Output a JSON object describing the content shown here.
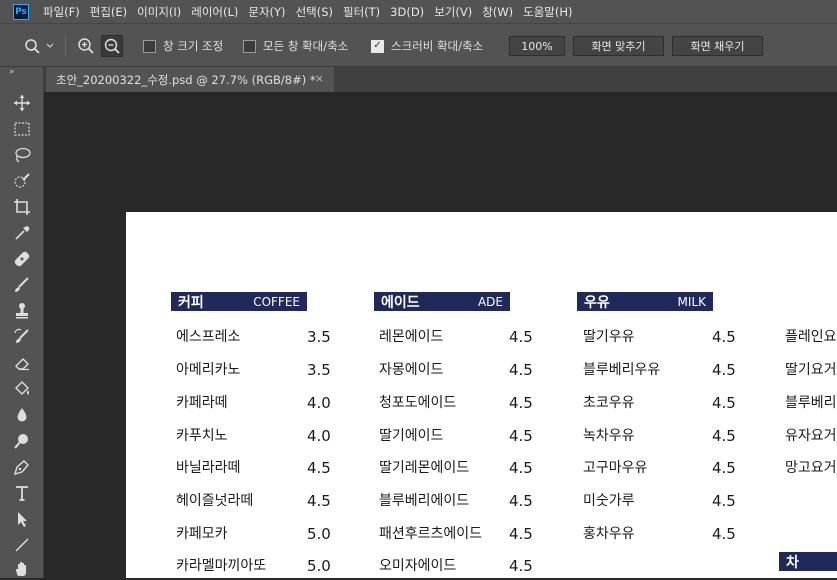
{
  "app": {
    "logo": "Ps"
  },
  "menu": [
    "파일(F)",
    "편집(E)",
    "이미지(I)",
    "레이어(L)",
    "문자(Y)",
    "선택(S)",
    "필터(T)",
    "3D(D)",
    "보기(V)",
    "창(W)",
    "도움말(H)"
  ],
  "options": {
    "resize_windows": "창 크기 조정",
    "zoom_all": "모든 창 확대/축소",
    "scrubby": "스크러비 확대/축소",
    "zoom_value": "100%",
    "fit_screen": "화면 맞추기",
    "fill_screen": "화면 채우기"
  },
  "tab": {
    "title": "초안_20200322_수정.psd @ 27.7% (RGB/8#) *",
    "close": "×"
  },
  "toolbar": {
    "grip": "»"
  },
  "menu_board": {
    "coffee": {
      "title": "커피",
      "title_en": "COFFEE",
      "items": [
        {
          "name": "에스프레소",
          "price": "3.5"
        },
        {
          "name": "아메리카노",
          "price": "3.5"
        },
        {
          "name": "카페라떼",
          "price": "4.0"
        },
        {
          "name": "카푸치노",
          "price": "4.0"
        },
        {
          "name": "바닐라라떼",
          "price": "4.5"
        },
        {
          "name": "헤이즐넛라떼",
          "price": "4.5"
        },
        {
          "name": "카페모카",
          "price": "5.0"
        },
        {
          "name": "카라멜마끼아또",
          "price": "5.0"
        }
      ]
    },
    "ade": {
      "title": "에이드",
      "title_en": "ADE",
      "items": [
        {
          "name": "레몬에이드",
          "price": "4.5"
        },
        {
          "name": "자몽에이드",
          "price": "4.5"
        },
        {
          "name": "청포도에이드",
          "price": "4.5"
        },
        {
          "name": "딸기에이드",
          "price": "4.5"
        },
        {
          "name": "딸기레몬에이드",
          "price": "4.5"
        },
        {
          "name": "블루베리에이드",
          "price": "4.5"
        },
        {
          "name": "패션후르츠에이드",
          "price": "4.5"
        },
        {
          "name": "오미자에이드",
          "price": "4.5"
        }
      ]
    },
    "milk": {
      "title": "우유",
      "title_en": "MILK",
      "items": [
        {
          "name": "딸기우유",
          "price": "4.5"
        },
        {
          "name": "블루베리우유",
          "price": "4.5"
        },
        {
          "name": "초코우유",
          "price": "4.5"
        },
        {
          "name": "녹차우유",
          "price": "4.5"
        },
        {
          "name": "고구마우유",
          "price": "4.5"
        },
        {
          "name": "미숫가루",
          "price": "4.5"
        },
        {
          "name": "홍차우유",
          "price": "4.5"
        }
      ]
    },
    "fourth": {
      "items": [
        "플레인요",
        "딸기요거",
        "블루베리",
        "유자요거",
        "망고요거"
      ],
      "tea_title": "차"
    }
  }
}
